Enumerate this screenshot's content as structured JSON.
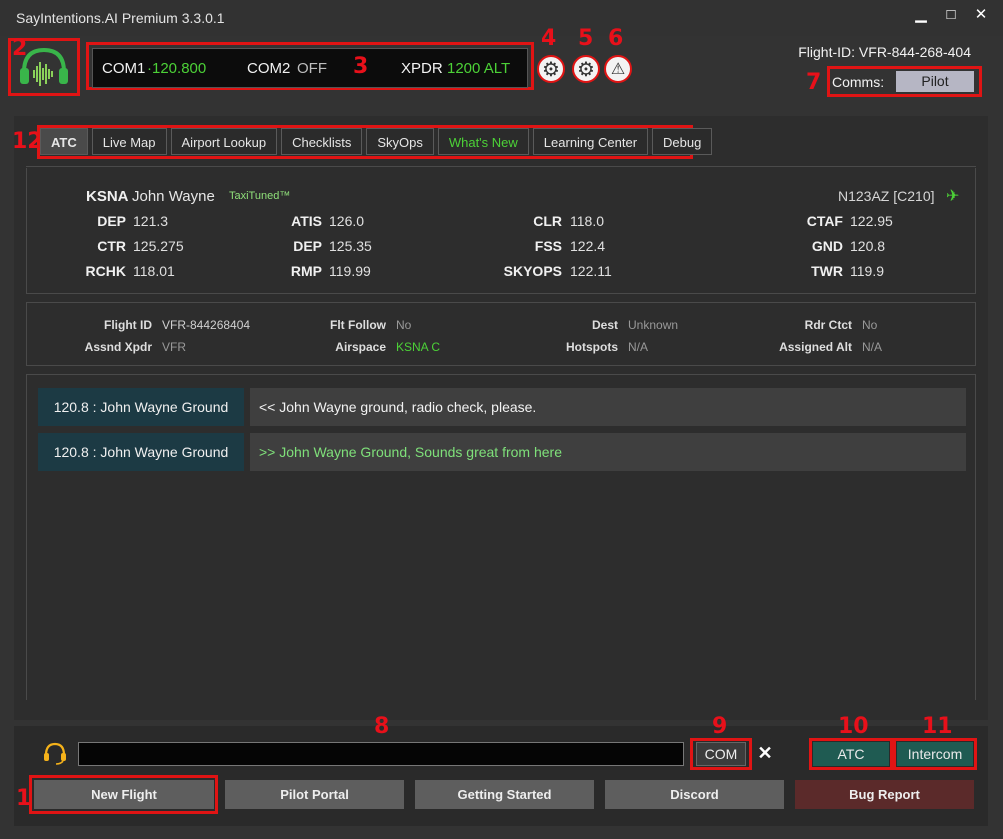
{
  "window": {
    "title": "SayIntentions.AI Premium  3.3.0.1",
    "minimize": "▁",
    "maximize": "□",
    "close": "✕"
  },
  "callouts": [
    "1",
    "2",
    "3",
    "4",
    "5",
    "6",
    "7",
    "8",
    "9",
    "10",
    "11",
    "12"
  ],
  "radio": {
    "com1_label": "COM1",
    "com1_value": "·120.800",
    "com2_label": "COM2",
    "com2_value": "OFF",
    "xpdr_label": "XPDR",
    "xpdr_value": "1200 ALT"
  },
  "header": {
    "flight_id": "Flight-ID: VFR-844-268-404",
    "comms_label": "Comms:",
    "comms_value": "Pilot"
  },
  "tabs": [
    {
      "label": "ATC"
    },
    {
      "label": "Live Map"
    },
    {
      "label": "Airport Lookup"
    },
    {
      "label": "Checklists"
    },
    {
      "label": "SkyOps"
    },
    {
      "label": "What's New"
    },
    {
      "label": "Learning Center"
    },
    {
      "label": "Debug"
    }
  ],
  "airport": {
    "code": "KSNA",
    "name": "John Wayne",
    "badge": "TaxiTuned™",
    "aircraft": "N123AZ [C210]",
    "freqs": [
      {
        "label": "DEP",
        "value": "121.3"
      },
      {
        "label": "CTR",
        "value": "125.275"
      },
      {
        "label": "RCHK",
        "value": "118.01"
      },
      {
        "label": "ATIS",
        "value": "126.0"
      },
      {
        "label": "DEP",
        "value": "125.35"
      },
      {
        "label": "RMP",
        "value": "119.99"
      },
      {
        "label": "CLR",
        "value": "118.0"
      },
      {
        "label": "FSS",
        "value": "122.4"
      },
      {
        "label": "SKYOPS",
        "value": "122.11"
      },
      {
        "label": "CTAF",
        "value": "122.95"
      },
      {
        "label": "GND",
        "value": "120.8"
      },
      {
        "label": "TWR",
        "value": "119.9"
      }
    ]
  },
  "flight_info": {
    "flight_id_label": "Flight ID",
    "flight_id_value": "VFR-844268404",
    "flt_follow_label": "Flt Follow",
    "flt_follow_value": "No",
    "dest_label": "Dest",
    "dest_value": "Unknown",
    "rdr_ctct_label": "Rdr Ctct",
    "rdr_ctct_value": "No",
    "assnd_xpdr_label": "Assnd Xpdr",
    "assnd_xpdr_value": "VFR",
    "airspace_label": "Airspace",
    "airspace_value": "KSNA C",
    "hotspots_label": "Hotspots",
    "hotspots_value": "N/A",
    "assigned_alt_label": "Assigned Alt",
    "assigned_alt_value": "N/A"
  },
  "messages": [
    {
      "freq": "120.8 : John Wayne Ground",
      "text": "<< John Wayne ground, radio check, please."
    },
    {
      "freq": "120.8 : John Wayne Ground",
      "text": ">> John Wayne Ground, Sounds great from here"
    }
  ],
  "input": {
    "value": "",
    "com_label": "COM",
    "clear_label": "✕"
  },
  "transmit": {
    "atc_label": "ATC",
    "intercom_label": "Intercom"
  },
  "footer": {
    "new_flight": "New Flight",
    "pilot_portal": "Pilot Portal",
    "getting_started": "Getting Started",
    "discord": "Discord",
    "bug_report": "Bug Report"
  },
  "colors": {
    "accent_green": "#4cd137",
    "callout_red": "#e01414",
    "atc_button": "#1f5b52",
    "message_freq_bg": "#1c3a44"
  }
}
